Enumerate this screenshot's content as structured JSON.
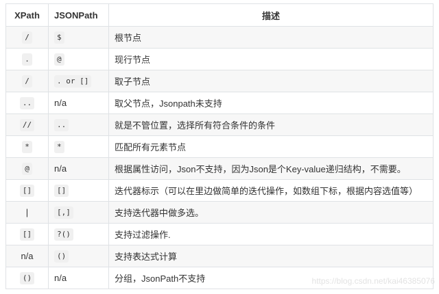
{
  "table": {
    "headers": [
      "XPath",
      "JSONPath",
      "描述"
    ],
    "rows": [
      {
        "xpath": "/",
        "xpath_code": true,
        "jsonpath": "$",
        "jsonpath_code": true,
        "desc": "根节点"
      },
      {
        "xpath": ".",
        "xpath_code": true,
        "jsonpath": "@",
        "jsonpath_code": true,
        "desc": "现行节点"
      },
      {
        "xpath": "/",
        "xpath_code": true,
        "jsonpath": ". or []",
        "jsonpath_code": true,
        "desc": "取子节点"
      },
      {
        "xpath": "..",
        "xpath_code": true,
        "jsonpath": "n/a",
        "jsonpath_code": false,
        "desc": "取父节点，Jsonpath未支持"
      },
      {
        "xpath": "//",
        "xpath_code": true,
        "jsonpath": "..",
        "jsonpath_code": true,
        "desc": "就是不管位置，选择所有符合条件的条件"
      },
      {
        "xpath": "*",
        "xpath_code": true,
        "jsonpath": "*",
        "jsonpath_code": true,
        "desc": "匹配所有元素节点"
      },
      {
        "xpath": "@",
        "xpath_code": true,
        "jsonpath": "n/a",
        "jsonpath_code": false,
        "desc": "根据属性访问，Json不支持，因为Json是个Key-value递归结构，不需要。"
      },
      {
        "xpath": "[]",
        "xpath_code": true,
        "jsonpath": "[]",
        "jsonpath_code": true,
        "desc": "迭代器标示（可以在里边做简单的迭代操作，如数组下标，根据内容选值等）"
      },
      {
        "xpath": "|",
        "xpath_code": false,
        "jsonpath": "[,]",
        "jsonpath_code": true,
        "desc": "支持迭代器中做多选。"
      },
      {
        "xpath": "[]",
        "xpath_code": true,
        "jsonpath": "?()",
        "jsonpath_code": true,
        "desc": "支持过滤操作."
      },
      {
        "xpath": "n/a",
        "xpath_code": false,
        "jsonpath": "()",
        "jsonpath_code": true,
        "desc": "支持表达式计算"
      },
      {
        "xpath": "()",
        "xpath_code": true,
        "jsonpath": "n/a",
        "jsonpath_code": false,
        "desc": "分组，JsonPath不支持"
      }
    ]
  },
  "watermark": "https://blog.csdn.net/kai46385076"
}
